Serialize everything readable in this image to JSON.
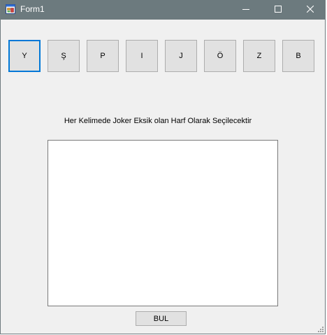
{
  "window": {
    "title": "Form1",
    "icons": {
      "app": "form-app-icon",
      "minimize": "minimize-icon",
      "maximize": "maximize-icon",
      "close": "close-icon"
    }
  },
  "letters": [
    {
      "label": "Y",
      "focused": true
    },
    {
      "label": "Ş"
    },
    {
      "label": "P"
    },
    {
      "label": "I"
    },
    {
      "label": "J"
    },
    {
      "label": "Ö"
    },
    {
      "label": "Z"
    },
    {
      "label": "B"
    }
  ],
  "instruction": "Her Kelimede Joker Eksik olan Harf Olarak Seçilecektir",
  "textbox": {
    "value": ""
  },
  "find_button": {
    "label": "BUL"
  },
  "colors": {
    "titlebar": "#6c7a7e",
    "focus_border": "#0078d7",
    "button_face": "#e1e1e1",
    "form_bg": "#f0f0f0"
  }
}
